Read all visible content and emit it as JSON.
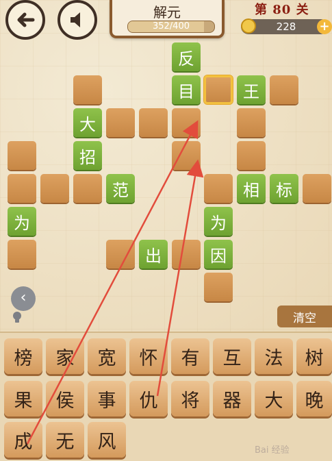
{
  "header": {
    "back_icon": "back-arrow-icon",
    "sound_icon": "speaker-icon",
    "title": "解元",
    "progress_text": "352/400",
    "progress_fraction": 0.88,
    "level": "第 80 关",
    "coins": "228",
    "add_coins_label": "+"
  },
  "board": {
    "green_cells": [
      "反",
      "目",
      "王",
      "大",
      "招",
      "范",
      "相",
      "标",
      "为",
      "为",
      "出",
      "因"
    ]
  },
  "controls": {
    "prev_label": "‹",
    "clear_label": "清空"
  },
  "tiles": {
    "row1": [
      "榜",
      "家",
      "宽",
      "怀",
      "有",
      "互",
      "法",
      "树"
    ],
    "row2": [
      "果",
      "侯",
      "事",
      "仇",
      "将",
      "器",
      "大",
      "晚"
    ],
    "row3": [
      "成",
      "无",
      "风"
    ]
  },
  "watermark": "Bai 经验",
  "colors": {
    "green_tile": "#7cb33c",
    "empty_tile": "#d49350",
    "arrow": "#e24c3c",
    "level_text": "#8b1f12"
  }
}
